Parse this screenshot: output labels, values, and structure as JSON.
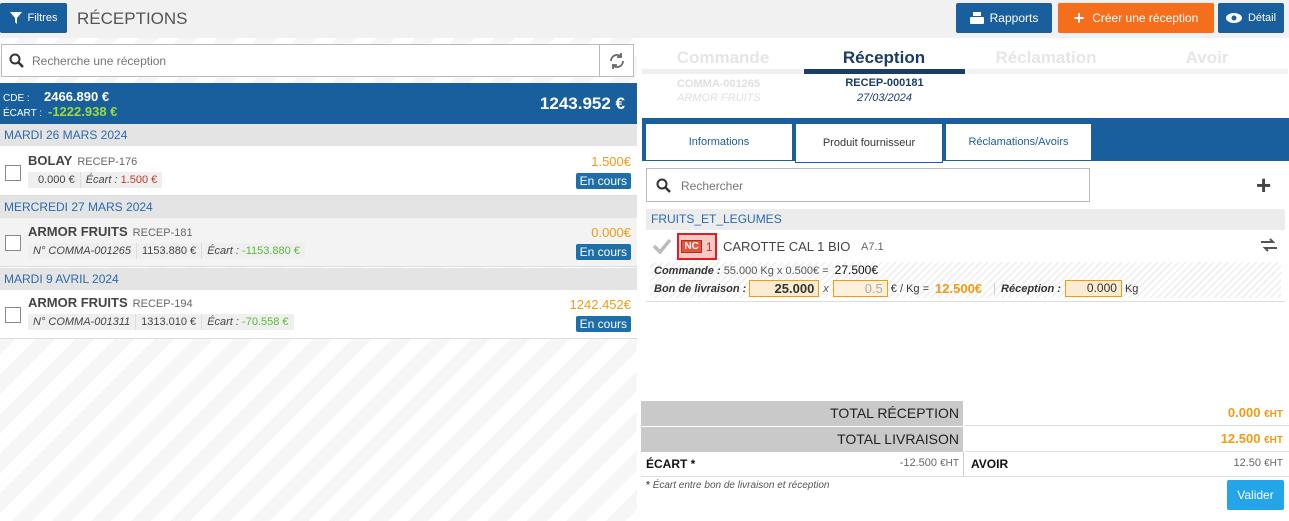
{
  "header": {
    "filters_label": "Filtres",
    "title": "RÉCEPTIONS",
    "reports_label": "Rapports",
    "create_label": "Créer une réception",
    "detail_label": "Détail"
  },
  "left": {
    "search_placeholder": "Recherche une réception",
    "summary": {
      "cde_label": "CDE :",
      "cde_value": "2466.890 €",
      "ecart_label": "ÉCART :",
      "ecart_value": "-1222.938 €",
      "total": "1243.952 €"
    },
    "groups": [
      {
        "date": "MARDI 26 MARS 2024",
        "items": [
          {
            "supplier": "BOLAY",
            "ref": "RECEP-176",
            "cmd": "",
            "cmd_amount": "0.000 €",
            "ecart_label": "Écart :",
            "ecart": "1.500 €",
            "amount": "1.500€",
            "status": "En cours"
          }
        ]
      },
      {
        "date": "MERCREDI 27 MARS 2024",
        "items": [
          {
            "supplier": "ARMOR FRUITS",
            "ref": "RECEP-181",
            "cmd": "N° COMMA-001265",
            "cmd_amount": "1153.880 €",
            "ecart_label": "Écart :",
            "ecart": "-1153.880 €",
            "amount": "0.000€",
            "status": "En cours"
          }
        ]
      },
      {
        "date": "MARDI 9 AVRIL 2024",
        "items": [
          {
            "supplier": "ARMOR FRUITS",
            "ref": "RECEP-194",
            "cmd": "N° COMMA-001311",
            "cmd_amount": "1313.010 €",
            "ecart_label": "Écart :",
            "ecart": "-70.558 €",
            "amount": "1242.452€",
            "status": "En cours"
          }
        ]
      }
    ]
  },
  "right": {
    "tabs": [
      {
        "label": "Commande",
        "line1": "COMMA-001265",
        "line2": "ARMOR FRUITS"
      },
      {
        "label": "Réception",
        "line1": "RECEP-000181",
        "line2": "27/03/2024"
      },
      {
        "label": "Réclamation",
        "line1": "",
        "line2": ""
      },
      {
        "label": "Avoir",
        "line1": "",
        "line2": ""
      }
    ],
    "subtabs": [
      "Informations",
      "Produit fournisseur",
      "Réclamations/Avoirs"
    ],
    "search_placeholder": "Rechercher",
    "category": "FRUITS_ET_LEGUMES",
    "product": {
      "nc": "NC",
      "nc_count": "1",
      "name": "CAROTTE CAL 1 BIO",
      "code": "A7.1",
      "commande_label": "Commande :",
      "commande_detail": "55.000 Kg x  0.500€ =",
      "commande_total": "27.500€",
      "bl_label": "Bon de livraison :",
      "bl_qty": "25.000",
      "bl_x": "x",
      "bl_price": "0.5",
      "bl_unit": "€ / Kg =",
      "bl_total": "12.500€",
      "rec_label": "Réception :",
      "rec_qty": "0.000",
      "rec_unit": "Kg"
    },
    "totals": {
      "reception_label": "TOTAL RÉCEPTION",
      "reception_value": "0.000",
      "delivery_label": "TOTAL LIVRAISON",
      "delivery_value": "12.500",
      "ht": "€HT",
      "ecart_label": "ÉCART *",
      "ecart_value": "-12.500",
      "avoir_label": "AVOIR",
      "avoir_value": "12.50"
    },
    "footnote_star": "*",
    "footnote": "Écart entre bon de livraison et réception",
    "validate_label": "Valider"
  }
}
